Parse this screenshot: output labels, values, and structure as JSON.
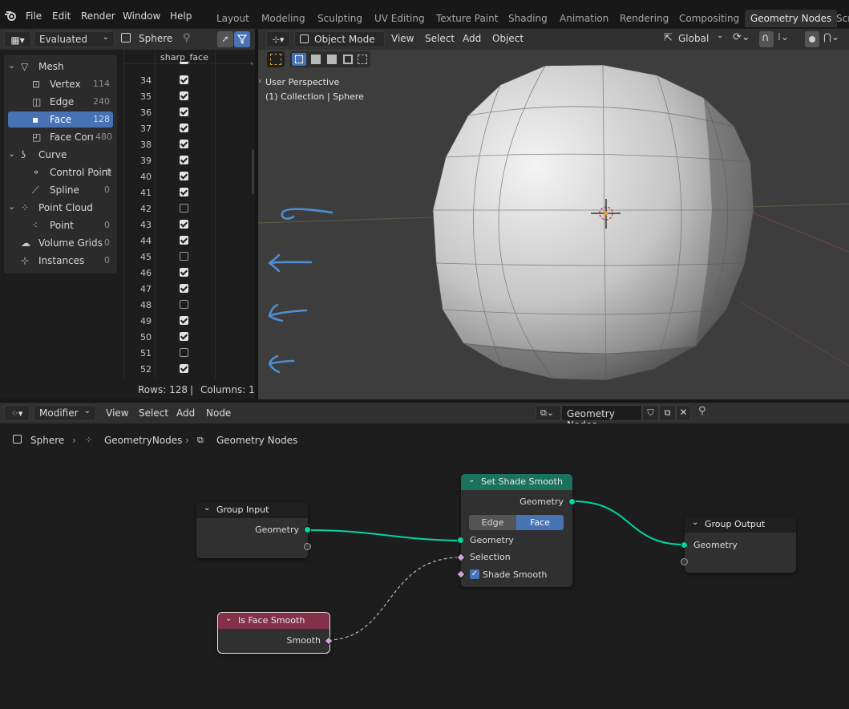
{
  "menu": {
    "items": [
      "File",
      "Edit",
      "Render",
      "Window",
      "Help"
    ]
  },
  "workspaces": {
    "tabs": [
      "Layout",
      "Modeling",
      "Sculpting",
      "UV Editing",
      "Texture Paint",
      "Shading",
      "Animation",
      "Rendering",
      "Compositing",
      "Geometry Nodes",
      "Scr"
    ],
    "active": "Geometry Nodes"
  },
  "spreadsheet": {
    "mode_dropdown": "Evaluated",
    "object_name": "Sphere",
    "column_header": "sharp_face",
    "tree": [
      {
        "label": "Mesh",
        "count": ""
      },
      {
        "label": "Vertex",
        "count": "114"
      },
      {
        "label": "Edge",
        "count": "240"
      },
      {
        "label": "Face",
        "count": "128"
      },
      {
        "label": "Face Corner",
        "count": "480"
      },
      {
        "label": "Curve",
        "count": ""
      },
      {
        "label": "Control Point",
        "count": "0"
      },
      {
        "label": "Spline",
        "count": "0"
      },
      {
        "label": "Point Cloud",
        "count": ""
      },
      {
        "label": "Point",
        "count": "0"
      },
      {
        "label": "Volume Grids",
        "count": "0"
      },
      {
        "label": "Instances",
        "count": "0"
      }
    ],
    "rows": [
      {
        "index": "34",
        "checked": true
      },
      {
        "index": "35",
        "checked": true
      },
      {
        "index": "36",
        "checked": true
      },
      {
        "index": "37",
        "checked": true
      },
      {
        "index": "38",
        "checked": true
      },
      {
        "index": "39",
        "checked": true
      },
      {
        "index": "40",
        "checked": true
      },
      {
        "index": "41",
        "checked": true
      },
      {
        "index": "42",
        "checked": false
      },
      {
        "index": "43",
        "checked": true
      },
      {
        "index": "44",
        "checked": true
      },
      {
        "index": "45",
        "checked": false
      },
      {
        "index": "46",
        "checked": true
      },
      {
        "index": "47",
        "checked": true
      },
      {
        "index": "48",
        "checked": false
      },
      {
        "index": "49",
        "checked": true
      },
      {
        "index": "50",
        "checked": true
      },
      {
        "index": "51",
        "checked": false
      },
      {
        "index": "52",
        "checked": true
      }
    ],
    "footer": {
      "rows": "Rows: 128",
      "separator": "|",
      "columns": "Columns: 1"
    }
  },
  "viewport": {
    "mode": "Object Mode",
    "menus": [
      "View",
      "Select",
      "Add",
      "Object"
    ],
    "orientation": "Global",
    "overlay_line1": "User Perspective",
    "overlay_line2": "(1) Collection | Sphere"
  },
  "node_editor": {
    "type_dropdown": "Modifier",
    "menus": [
      "View",
      "Select",
      "Add",
      "Node"
    ],
    "node_group": "Geometry Nodes",
    "breadcrumb": [
      "Sphere",
      "GeometryNodes",
      "Geometry Nodes"
    ],
    "nodes": {
      "group_input": {
        "title": "Group Input",
        "output": "Geometry"
      },
      "set_shade_smooth": {
        "title": "Set Shade Smooth",
        "output": "Geometry",
        "domain_options": [
          "Edge",
          "Face"
        ],
        "domain_selected": "Face",
        "inputs": [
          "Geometry",
          "Selection",
          "Shade Smooth"
        ],
        "shade_smooth_checked": true
      },
      "group_output": {
        "title": "Group Output",
        "input": "Geometry"
      },
      "is_face_smooth": {
        "title": "Is Face Smooth",
        "output": "Smooth"
      }
    }
  },
  "colors": {
    "accent_blue": "#4772b3",
    "geometry_socket": "#00d6a3",
    "field_socket": "#cca6d6",
    "set_shade_header": "#1d725e",
    "input_header": "#83314a"
  }
}
